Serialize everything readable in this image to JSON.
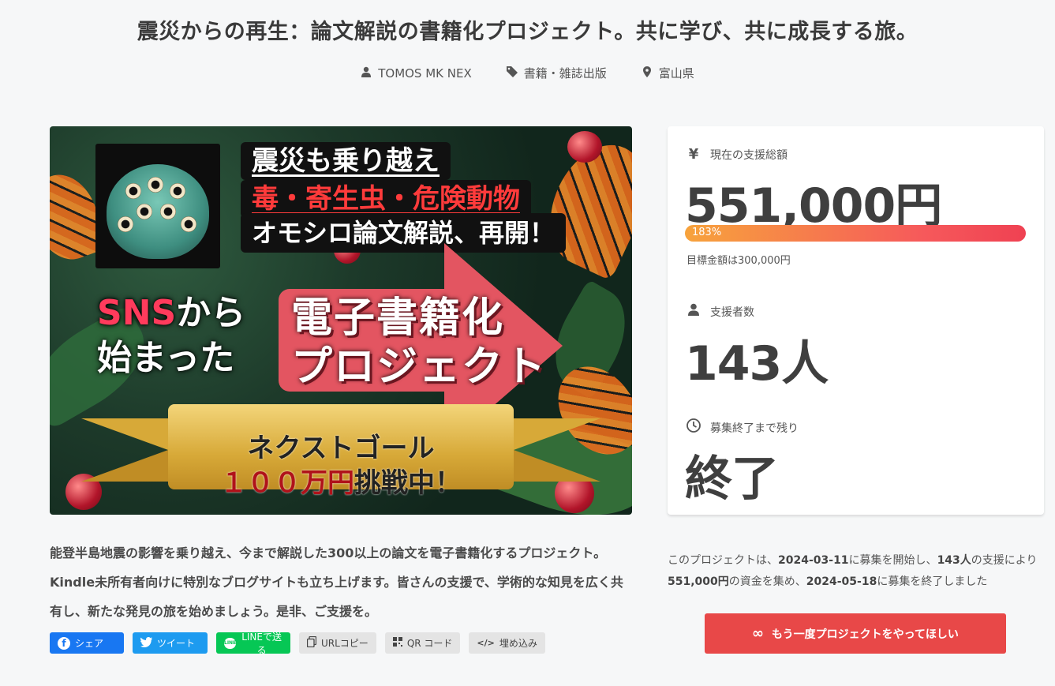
{
  "title": "震災からの再生：論文解説の書籍化プロジェクト。共に学び、共に成長する旅。",
  "meta": {
    "owner": "TOMOS MK NEX",
    "category": "書籍・雑誌出版",
    "location": "富山県"
  },
  "hero": {
    "banner_line1": "震災も乗り越え",
    "banner_line2": "毒・寄生虫・危険動物",
    "banner_line3": "オモシロ論文解説、再開！",
    "sns_red": "SNS",
    "sns_rest": "から",
    "sns_line2": "始まった",
    "ebook_line1": "電子書籍化",
    "ebook_line2": "プロジェクト",
    "goal_line1": "ネクストゴール",
    "goal_line2_red": "１００万円",
    "goal_line2_dark": "挑戦中！"
  },
  "description": "能登半島地震の影響を乗り越え、今まで解説した300以上の論文を電子書籍化するプロジェクト。Kindle未所有者向けに特別なブログサイトも立ち上げます。皆さんの支援で、学術的な知見を広く共有し、新たな発見の旅を始めましょう。是非、ご支援を。",
  "share": {
    "facebook": "シェア",
    "twitter": "ツイート",
    "line": "LINEで送る",
    "line_badge": "LINE",
    "url_copy": "URLコピー",
    "qr": "QR コード",
    "embed": "埋め込み"
  },
  "stats": {
    "amount_label": "現在の支援総額",
    "amount": "551,000円",
    "progress_text": "183%",
    "progress_fraction": 1.0,
    "goal_text": "目標金額は300,000円",
    "supporters_label": "支援者数",
    "supporters": "143人",
    "remaining_label": "募集終了まで残り",
    "remaining": "終了"
  },
  "summary": {
    "p1": "このプロジェクトは、",
    "start_date": "2024-03-11",
    "p2": "に募集を開始し、",
    "supporters": "143人",
    "p3": "の支援により",
    "amount": "551,000円",
    "p4": "の資金を集め、",
    "end_date": "2024-05-18",
    "p5": "に募集を終了しました"
  },
  "cta_label": "もう一度プロジェクトをやってほしい",
  "colors": {
    "cta": "#e84848",
    "facebook": "#1877f2",
    "twitter": "#1d9bf0",
    "line": "#06c755"
  }
}
